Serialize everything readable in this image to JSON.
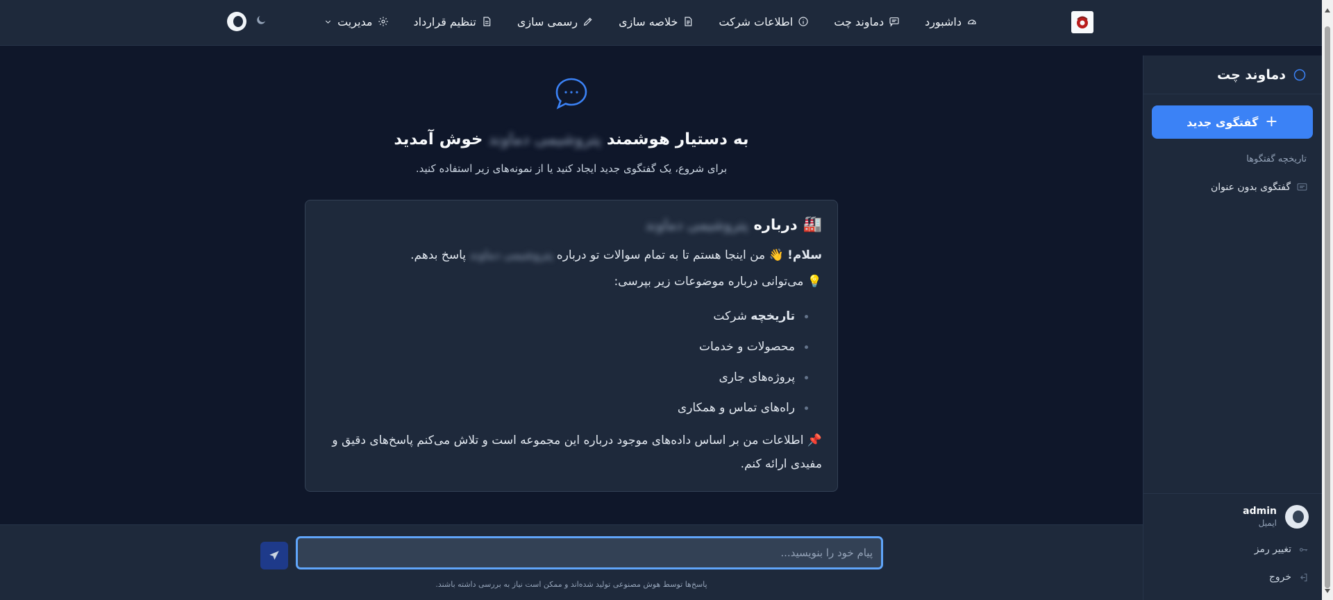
{
  "nav": {
    "items": [
      {
        "label": "داشبورد",
        "icon": "gauge-icon"
      },
      {
        "label": "دماوند چت",
        "icon": "message-icon"
      },
      {
        "label": "اطلاعات شرکت",
        "icon": "info-icon"
      },
      {
        "label": "خلاصه سازی",
        "icon": "document-icon"
      },
      {
        "label": "رسمی سازی",
        "icon": "pen-icon"
      },
      {
        "label": "تنظیم قرارداد",
        "icon": "contract-icon"
      },
      {
        "label": "مدیریت",
        "icon": "gear-icon"
      }
    ]
  },
  "sidebar": {
    "title": "دماوند چت",
    "new_chat_label": "گفتگوی جدید",
    "history_label": "تاریخچه گفتگوها",
    "history": [
      {
        "label": "گفتگوی بدون عنوان"
      }
    ],
    "user_name": "admin",
    "user_sub": "ایمیل",
    "change_password": "تغییر رمز",
    "logout": "خروج"
  },
  "main": {
    "welcome_prefix": "به دستیار هوشمند",
    "welcome_blurred": "پتروشیمی دماوند",
    "welcome_suffix": "خوش آمدید",
    "subtitle": "برای شروع، یک گفتگوی جدید ایجاد کنید یا از نمونه‌های زیر استفاده کنید.",
    "card": {
      "emoji": "🏭",
      "title_prefix": "درباره",
      "title_blurred": "پتروشیمی دماوند",
      "hello_bold": "سلام!",
      "hello_emoji": "👋",
      "hello_text_a": "من اینجا هستم تا به تمام سوالات تو درباره",
      "hello_blurred": "پتروشیمی دماوند",
      "hello_text_b": "پاسخ بدهم.",
      "topics_emoji": "💡",
      "topics_intro": "می‌توانی درباره موضوعات زیر بپرسی:",
      "topics": [
        {
          "bold": "تاریخچه",
          "text": "شرکت"
        },
        {
          "bold": "",
          "text": "محصولات و خدمات"
        },
        {
          "bold": "",
          "text": "پروژه‌های جاری"
        },
        {
          "bold": "",
          "text": "راه‌های تماس و همکاری"
        }
      ],
      "note_emoji": "📌",
      "note": "اطلاعات من بر اساس داده‌های موجود درباره این مجموعه است و تلاش می‌کنم پاسخ‌های دقیق و مفیدی ارائه کنم."
    }
  },
  "composer": {
    "placeholder": "پیام خود را بنویسید...",
    "disclaimer": "پاسخ‌ها توسط هوش مصنوعی تولید شده‌اند و ممکن است نیاز به بررسی داشته باشند."
  },
  "colors": {
    "accent": "#3b82f6",
    "background": "#0f172a",
    "panel": "#1e293b"
  }
}
